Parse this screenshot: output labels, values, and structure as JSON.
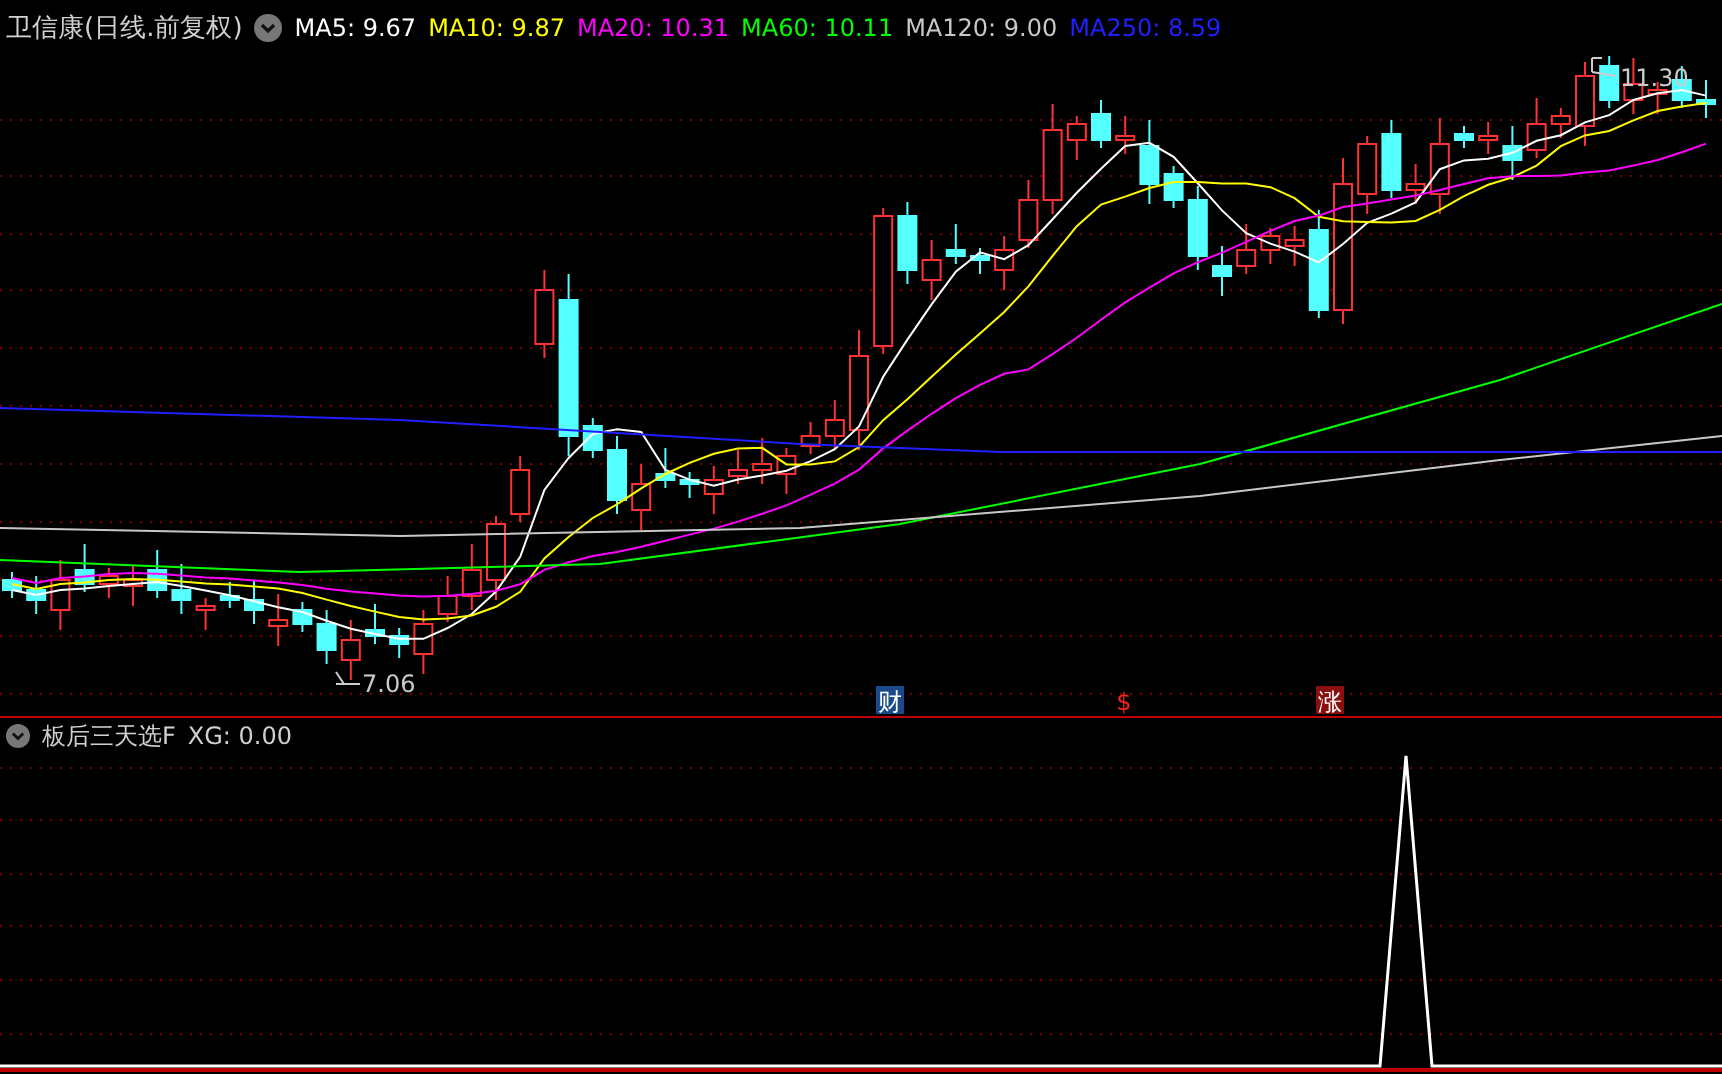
{
  "title": "卫信康(日线.前复权)",
  "moving_averages": [
    {
      "label": "MA5: 9.67",
      "color": "#ffffff"
    },
    {
      "label": "MA10: 9.87",
      "color": "#ffff00"
    },
    {
      "label": "MA20: 10.31",
      "color": "#ff00ff"
    },
    {
      "label": "MA60: 10.11",
      "color": "#00ff00"
    },
    {
      "label": "MA120: 9.00",
      "color": "#c8c8c8"
    },
    {
      "label": "MA250: 8.59",
      "color": "#2020ff"
    }
  ],
  "price_labels": {
    "high": "11.30",
    "low": "7.06"
  },
  "event_markers": [
    {
      "text": "财",
      "kind": "finance"
    },
    {
      "text": "$",
      "kind": "dollar"
    },
    {
      "text": "涨",
      "kind": "limit"
    }
  ],
  "indicator": {
    "name": "板后三天选F",
    "reading": "XG: 0.00"
  }
}
